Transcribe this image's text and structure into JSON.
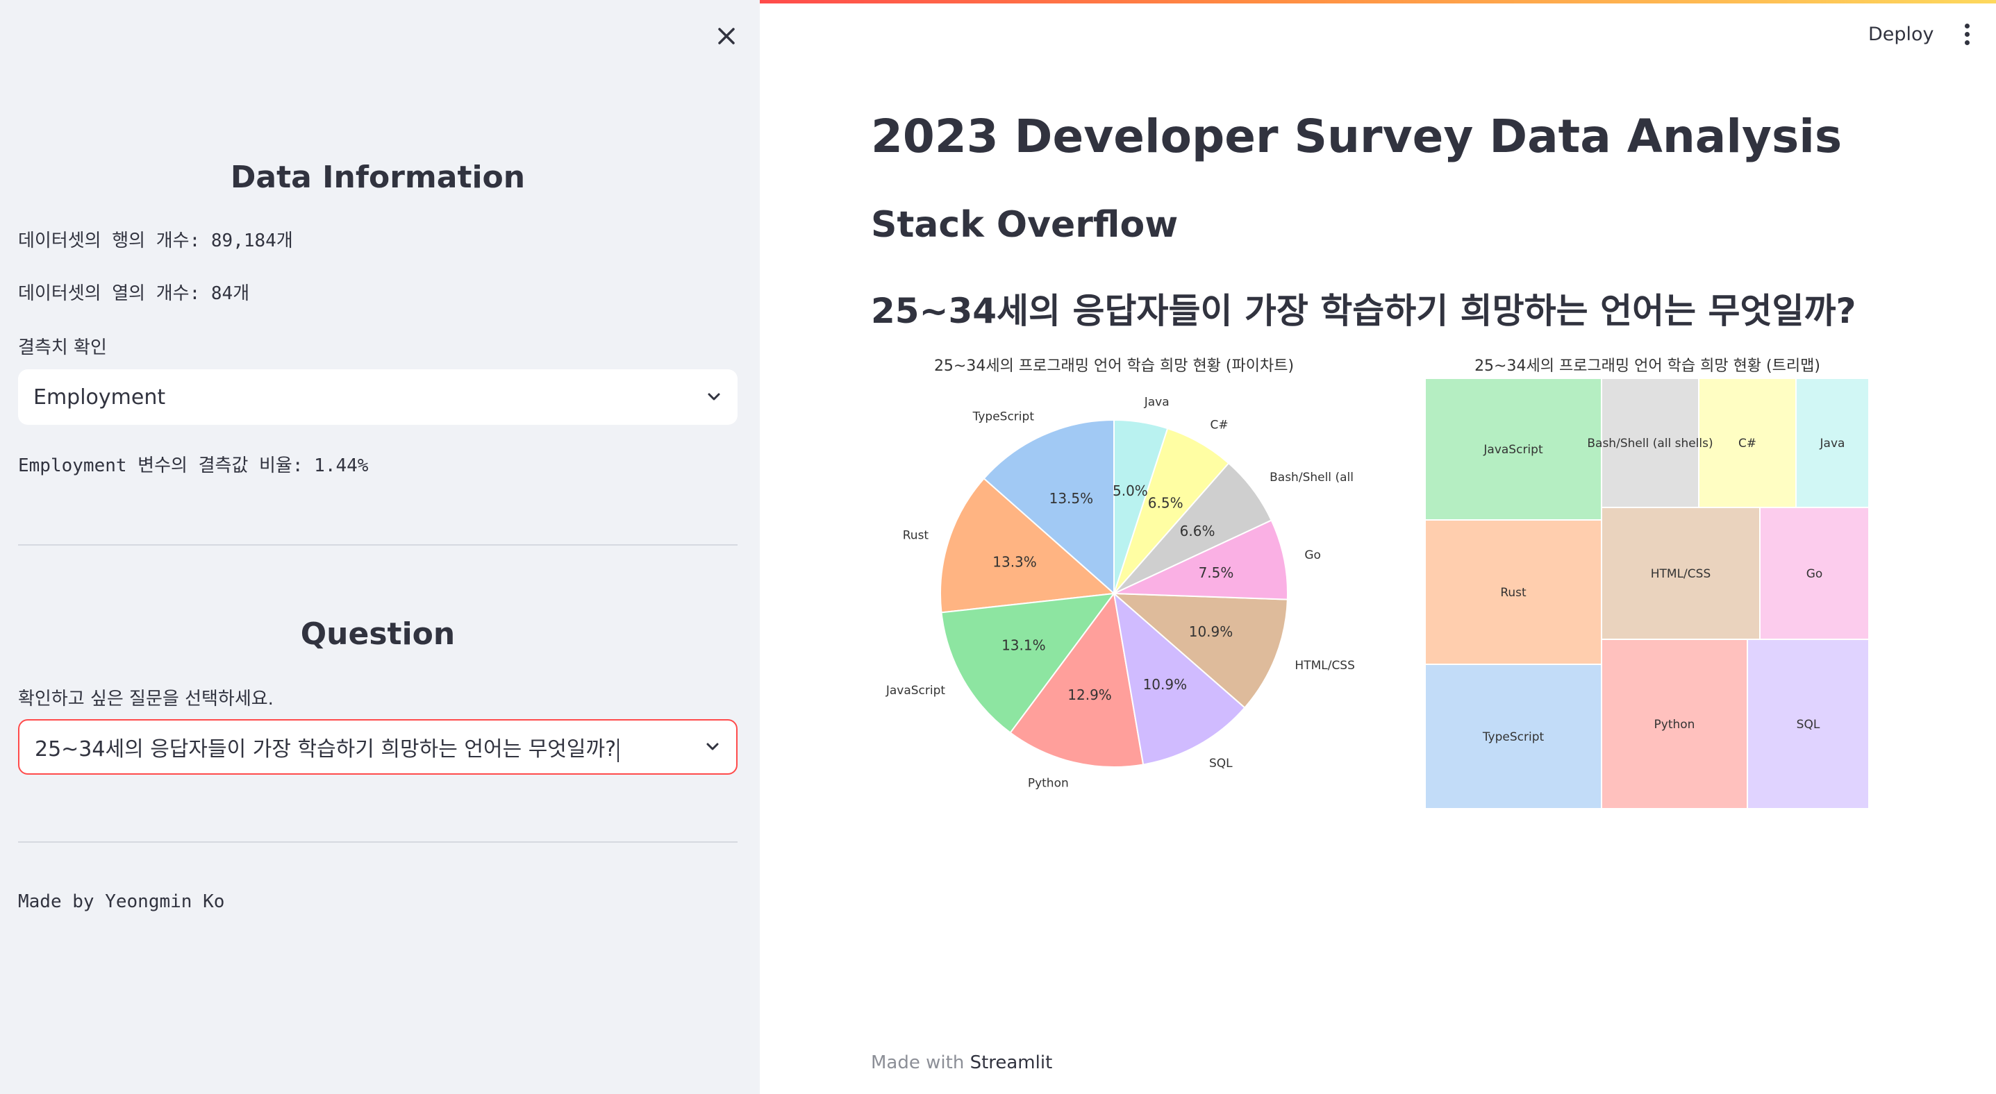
{
  "sidebar": {
    "data_info_title": "Data Information",
    "rows_text": "데이터셋의 행의 개수: 89,184개",
    "cols_text": "데이터셋의 열의 개수: 84개",
    "missing_label": "결측치 확인",
    "missing_select_value": "Employment",
    "missing_ratio_text": "Employment 변수의 결측값 비율: 1.44%",
    "question_title": "Question",
    "question_label": "확인하고 싶은 질문을 선택하세요.",
    "question_select_value": "25~34세의 응답자들이 가장 학습하기 희망하는 언어는 무엇일까?",
    "made_by": "Made by Yeongmin Ko"
  },
  "header": {
    "deploy_label": "Deploy"
  },
  "main": {
    "title": "2023 Developer Survey Data Analysis",
    "subtitle": "Stack Overflow",
    "question_heading": "25~34세의 응답자들이 가장 학습하기 희망하는 언어는 무엇일까?",
    "footer_prefix": "Made with ",
    "footer_brand": "Streamlit"
  },
  "chart_data": [
    {
      "type": "pie",
      "title": "25~34세의 프로그래밍 언어 학습 희망 현황 (파이차트)",
      "categories": [
        "TypeScript",
        "Rust",
        "JavaScript",
        "Python",
        "SQL",
        "HTML/CSS",
        "Go",
        "Bash/Shell (all shells)",
        "C#",
        "Java"
      ],
      "values": [
        13.5,
        13.3,
        13.1,
        12.9,
        10.9,
        10.9,
        7.5,
        6.6,
        6.5,
        5.0
      ],
      "labels": [
        "13.5%",
        "13.3%",
        "13.1%",
        "12.9%",
        "10.9%",
        "10.9%",
        "7.5%",
        "6.6%",
        "6.5%",
        "5.0%"
      ],
      "colors": [
        "#a1c9f4",
        "#ffb482",
        "#8de5a1",
        "#ff9f9b",
        "#d0bbff",
        "#debb9b",
        "#fab0e4",
        "#cfcfcf",
        "#fffea3",
        "#b9f2f0"
      ]
    },
    {
      "type": "treemap",
      "title": "25~34세의 프로그래밍 언어 학습 희망 현황 (트리맵)",
      "categories": [
        "JavaScript",
        "Bash/Shell (all shells)",
        "C#",
        "Java",
        "Rust",
        "HTML/CSS",
        "Go",
        "TypeScript",
        "Python",
        "SQL"
      ],
      "colors": [
        "#8de5a1",
        "#cfcfcf",
        "#fffea3",
        "#b9f2f0",
        "#ffb482",
        "#debb9b",
        "#fab0e4",
        "#a1c9f4",
        "#ff9f9b",
        "#d0bbff"
      ]
    }
  ]
}
